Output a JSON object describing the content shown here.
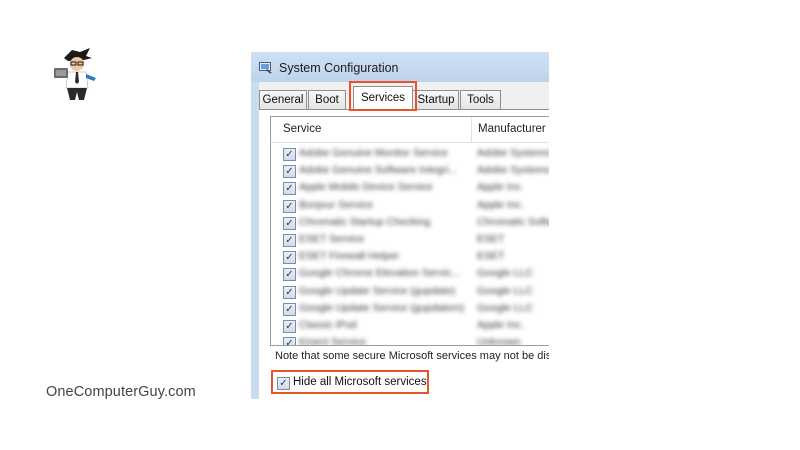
{
  "brand": {
    "site": "OneComputerGuy.com",
    "logo_icon": "computer-guy-mascot-icon"
  },
  "window": {
    "title": "System Configuration",
    "icon": "msconfig-icon",
    "tabs": [
      {
        "label": "General",
        "active": false
      },
      {
        "label": "Boot",
        "active": false
      },
      {
        "label": "Services",
        "active": true,
        "highlighted": true
      },
      {
        "label": "Startup",
        "active": false
      },
      {
        "label": "Tools",
        "active": false
      }
    ]
  },
  "services": {
    "columns": {
      "service": "Service",
      "manufacturer": "Manufacturer"
    },
    "rows": [
      {
        "checked": true,
        "name": "Adobe Genuine Monitor Service",
        "manufacturer": "Adobe Systems"
      },
      {
        "checked": true,
        "name": "Adobe Genuine Software Integri...",
        "manufacturer": "Adobe Systems"
      },
      {
        "checked": true,
        "name": "Apple Mobile Device Service",
        "manufacturer": "Apple Inc."
      },
      {
        "checked": true,
        "name": "Bonjour Service",
        "manufacturer": "Apple Inc."
      },
      {
        "checked": true,
        "name": "Chromatic Startup Checking",
        "manufacturer": "Chromatic Software"
      },
      {
        "checked": true,
        "name": "ESET Service",
        "manufacturer": "ESET"
      },
      {
        "checked": true,
        "name": "ESET Firewall Helper",
        "manufacturer": "ESET"
      },
      {
        "checked": true,
        "name": "Google Chrome Elevation Servic...",
        "manufacturer": "Google LLC"
      },
      {
        "checked": true,
        "name": "Google Update Service (gupdate)",
        "manufacturer": "Google LLC"
      },
      {
        "checked": true,
        "name": "Google Update Service (gupdatem)",
        "manufacturer": "Google LLC"
      },
      {
        "checked": true,
        "name": "Classic iPod",
        "manufacturer": "Apple Inc."
      },
      {
        "checked": true,
        "name": "Kinect Service",
        "manufacturer": "Unknown"
      }
    ],
    "check_glyph": "✓"
  },
  "footer": {
    "note": "Note that some secure Microsoft services may not be dis",
    "hide_ms_label": "Hide all Microsoft services",
    "hide_ms_checked": true
  },
  "colors": {
    "highlight": "#e8542a",
    "titlebar": "#c9dbef"
  }
}
